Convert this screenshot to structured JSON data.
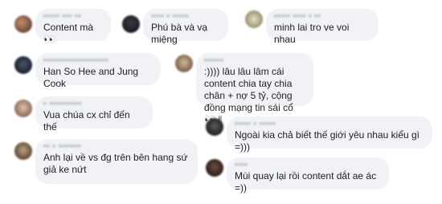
{
  "comments": [
    {
      "name": "▪▪▪▪▪ ▪▪▪ ▪▪",
      "text": "Content mà 👀"
    },
    {
      "name": "▪▪▪▪ ▪ ▪▪▪▪▪",
      "text": "Phú bà và vạ miệng"
    },
    {
      "name": "▪▪▪▪▪ ▪▪▪▪ ▪ ▪▪",
      "text": "minh lai tro ve voi nhau"
    },
    {
      "name": "▪▪▪▪▪▪▪▪▪▪▪▪▪▪▪▪▪▪▪▪",
      "text": "Han So Hee and Jung Cook"
    },
    {
      "name": "▪▪▪▪▪▪",
      "text": ":)))) lâu lâu lâm cái content chia tay chia chân + nợ 5 tỷ, cộng đồng mạng tin sái cổ 👀✌"
    },
    {
      "name": "▪ ▪▪▪▪▪▪▪▪▪▪",
      "text": "Vua chúa cx chỉ đến thế"
    },
    {
      "name": "▪▪▪▪▪ ▪ ▪▪▪▪▪",
      "text": "Ngoài kia chả biết thế giới yêu nhau kiểu gì =)))"
    },
    {
      "name": "▪▪ ▪ ▪▪▪▪▪▪▪",
      "text": "Anh lại về vs đg trên bên hang sứ giả ke nứt"
    },
    {
      "name": "▪▪▪▪",
      "text": "Mùi quay lại rồi content dắt ae ác =))"
    }
  ]
}
